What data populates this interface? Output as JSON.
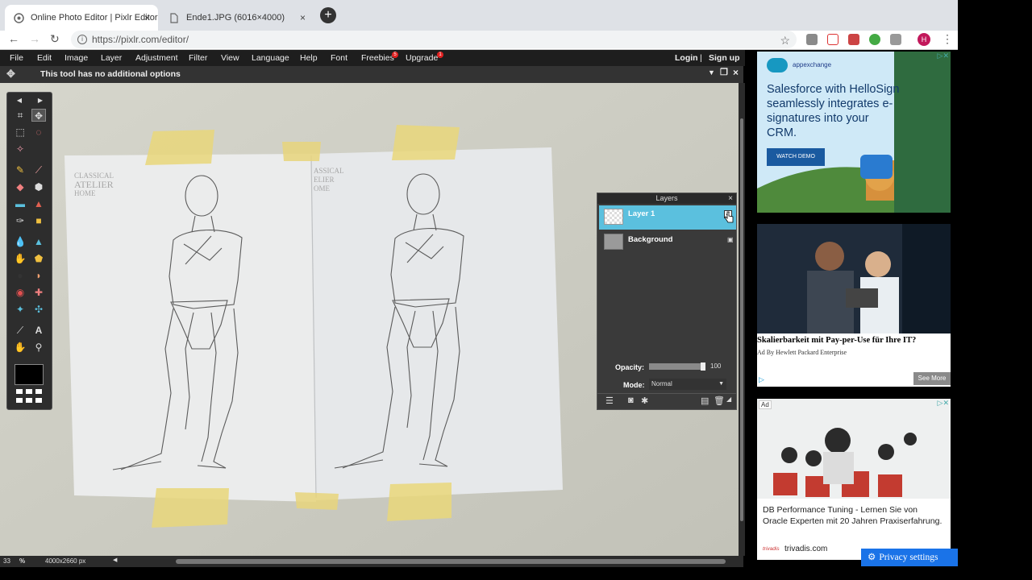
{
  "browser": {
    "tabs": [
      {
        "title": "Online Photo Editor | Pixlr Editor",
        "active": true,
        "close": "×"
      },
      {
        "title": "Ende1.JPG (6016×4000)",
        "active": false,
        "close": "×"
      }
    ],
    "new_tab": "+",
    "url": "https://pixlr.com/editor/",
    "profile_initial": "H",
    "nav": {
      "back": "←",
      "forward": "→",
      "reload": "↻"
    }
  },
  "menubar": {
    "items": [
      "File",
      "Edit",
      "Image",
      "Layer",
      "Adjustment",
      "Filter",
      "View",
      "Language",
      "Help",
      "Font",
      "Freebies",
      "Upgrade"
    ],
    "freebies_badge": "5",
    "upgrade_badge": "1",
    "login": "Login",
    "separator": "|",
    "signup": "Sign up"
  },
  "options_bar": {
    "message": "This tool has no additional options"
  },
  "canvas_image": {
    "left_watermark": [
      "CLASSICAL",
      "ATELIER",
      "HOME"
    ],
    "right_watermark": [
      "ASSICAL",
      "ELIER",
      "OME"
    ]
  },
  "layers_panel": {
    "title": "Layers",
    "close": "×",
    "layers": [
      {
        "name": "Layer 1",
        "selected": true
      },
      {
        "name": "Background",
        "selected": false
      }
    ],
    "opacity_label": "Opacity:",
    "opacity_value": "100",
    "opacity_level": 1.0,
    "mode_label": "Mode:",
    "mode_value": "Normal"
  },
  "status": {
    "zoom": "33",
    "zoom_unit": "%",
    "dimensions": "4000x2660 px"
  },
  "ads": {
    "ad1": {
      "brand": "appexchange",
      "headline": "Salesforce with HelloSign seamlessly integrates e-signatures into your CRM.",
      "cta": "WATCH DEMO"
    },
    "ad2": {
      "title": "Skalierbarkeit mit Pay-per-Use für Ihre IT?",
      "sponsor": "Ad By Hewlett Packard Enterprise",
      "cta": "See More"
    },
    "ad3": {
      "label": "Ad",
      "text": "DB Performance Tuning - Lernen Sie von Oracle Experten mit 20 Jahren Praxiserfahrung.",
      "brand_logo": "trivadis",
      "domain": "trivadis.com",
      "privacy": "Privacy settings"
    }
  },
  "colors": {
    "accent": "#5bc0de",
    "menu_bg": "#1e1e1e",
    "canvas_bg": "#cfcfc5"
  }
}
